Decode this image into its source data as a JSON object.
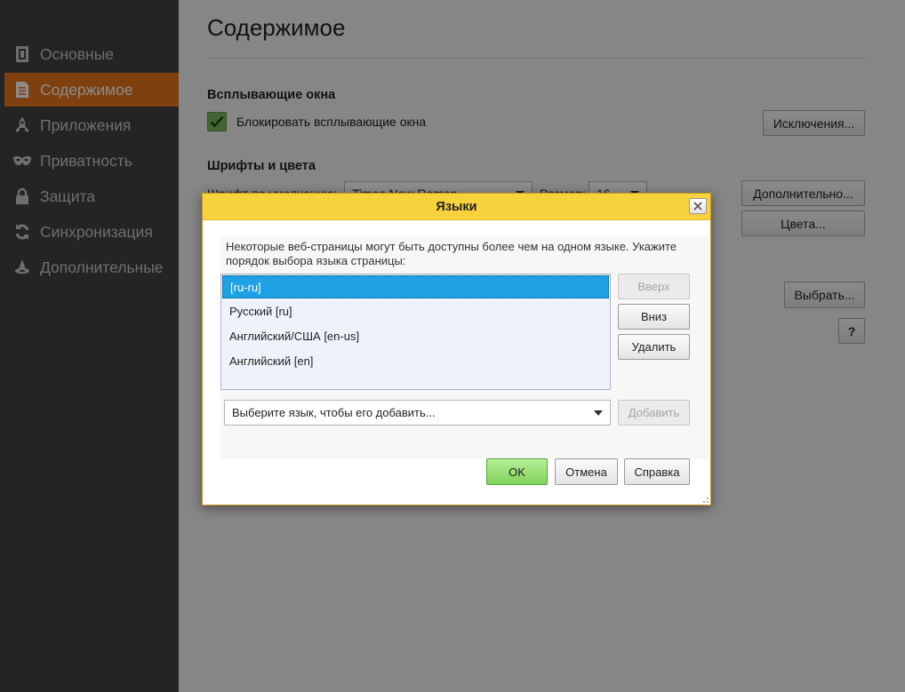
{
  "sidebar": {
    "items": [
      {
        "label": "Основные",
        "icon": "general-icon",
        "active": false
      },
      {
        "label": "Содержимое",
        "icon": "content-icon",
        "active": true
      },
      {
        "label": "Приложения",
        "icon": "rocket-icon",
        "active": false
      },
      {
        "label": "Приватность",
        "icon": "mask-icon",
        "active": false
      },
      {
        "label": "Защита",
        "icon": "lock-icon",
        "active": false
      },
      {
        "label": "Синхронизация",
        "icon": "sync-icon",
        "active": false
      },
      {
        "label": "Дополнительные",
        "icon": "wizard-icon",
        "active": false
      }
    ]
  },
  "main": {
    "title": "Содержимое",
    "popups": {
      "heading": "Всплывающие окна",
      "block_label": "Блокировать всплывающие окна",
      "block_checked": true,
      "exceptions_button": "Исключения..."
    },
    "fonts": {
      "heading": "Шрифты и цвета",
      "default_font_label": "Шрифт по умолчанию:",
      "default_font_value": "Times New Roman",
      "size_label": "Размер:",
      "size_value": "16",
      "advanced_button": "Дополнительно...",
      "colors_button": "Цвета..."
    },
    "languages": {
      "choose_button": "Выбрать...",
      "help_button": "?"
    }
  },
  "dialog": {
    "title": "Языки",
    "close_icon": "close-icon",
    "description": "Некоторые веб-страницы могут быть доступны более чем на одном языке. Укажите порядок выбора языка страницы:",
    "languages": [
      {
        "label": "[ru-ru]",
        "selected": true
      },
      {
        "label": "Русский  [ru]",
        "selected": false
      },
      {
        "label": "Английский/США  [en-us]",
        "selected": false
      },
      {
        "label": "Английский  [en]",
        "selected": false
      }
    ],
    "move_up": "Вверх",
    "move_down": "Вниз",
    "remove": "Удалить",
    "select_placeholder": "Выберите язык, чтобы его добавить...",
    "add": "Добавить",
    "ok": "OK",
    "cancel": "Отмена",
    "help": "Справка"
  },
  "colors": {
    "sidebar_bg": "#424242",
    "active_item": "#e8761d",
    "dialog_titlebar": "#f8d23c",
    "selection": "#1fa1e5",
    "ok_button": "#8fdc67"
  }
}
